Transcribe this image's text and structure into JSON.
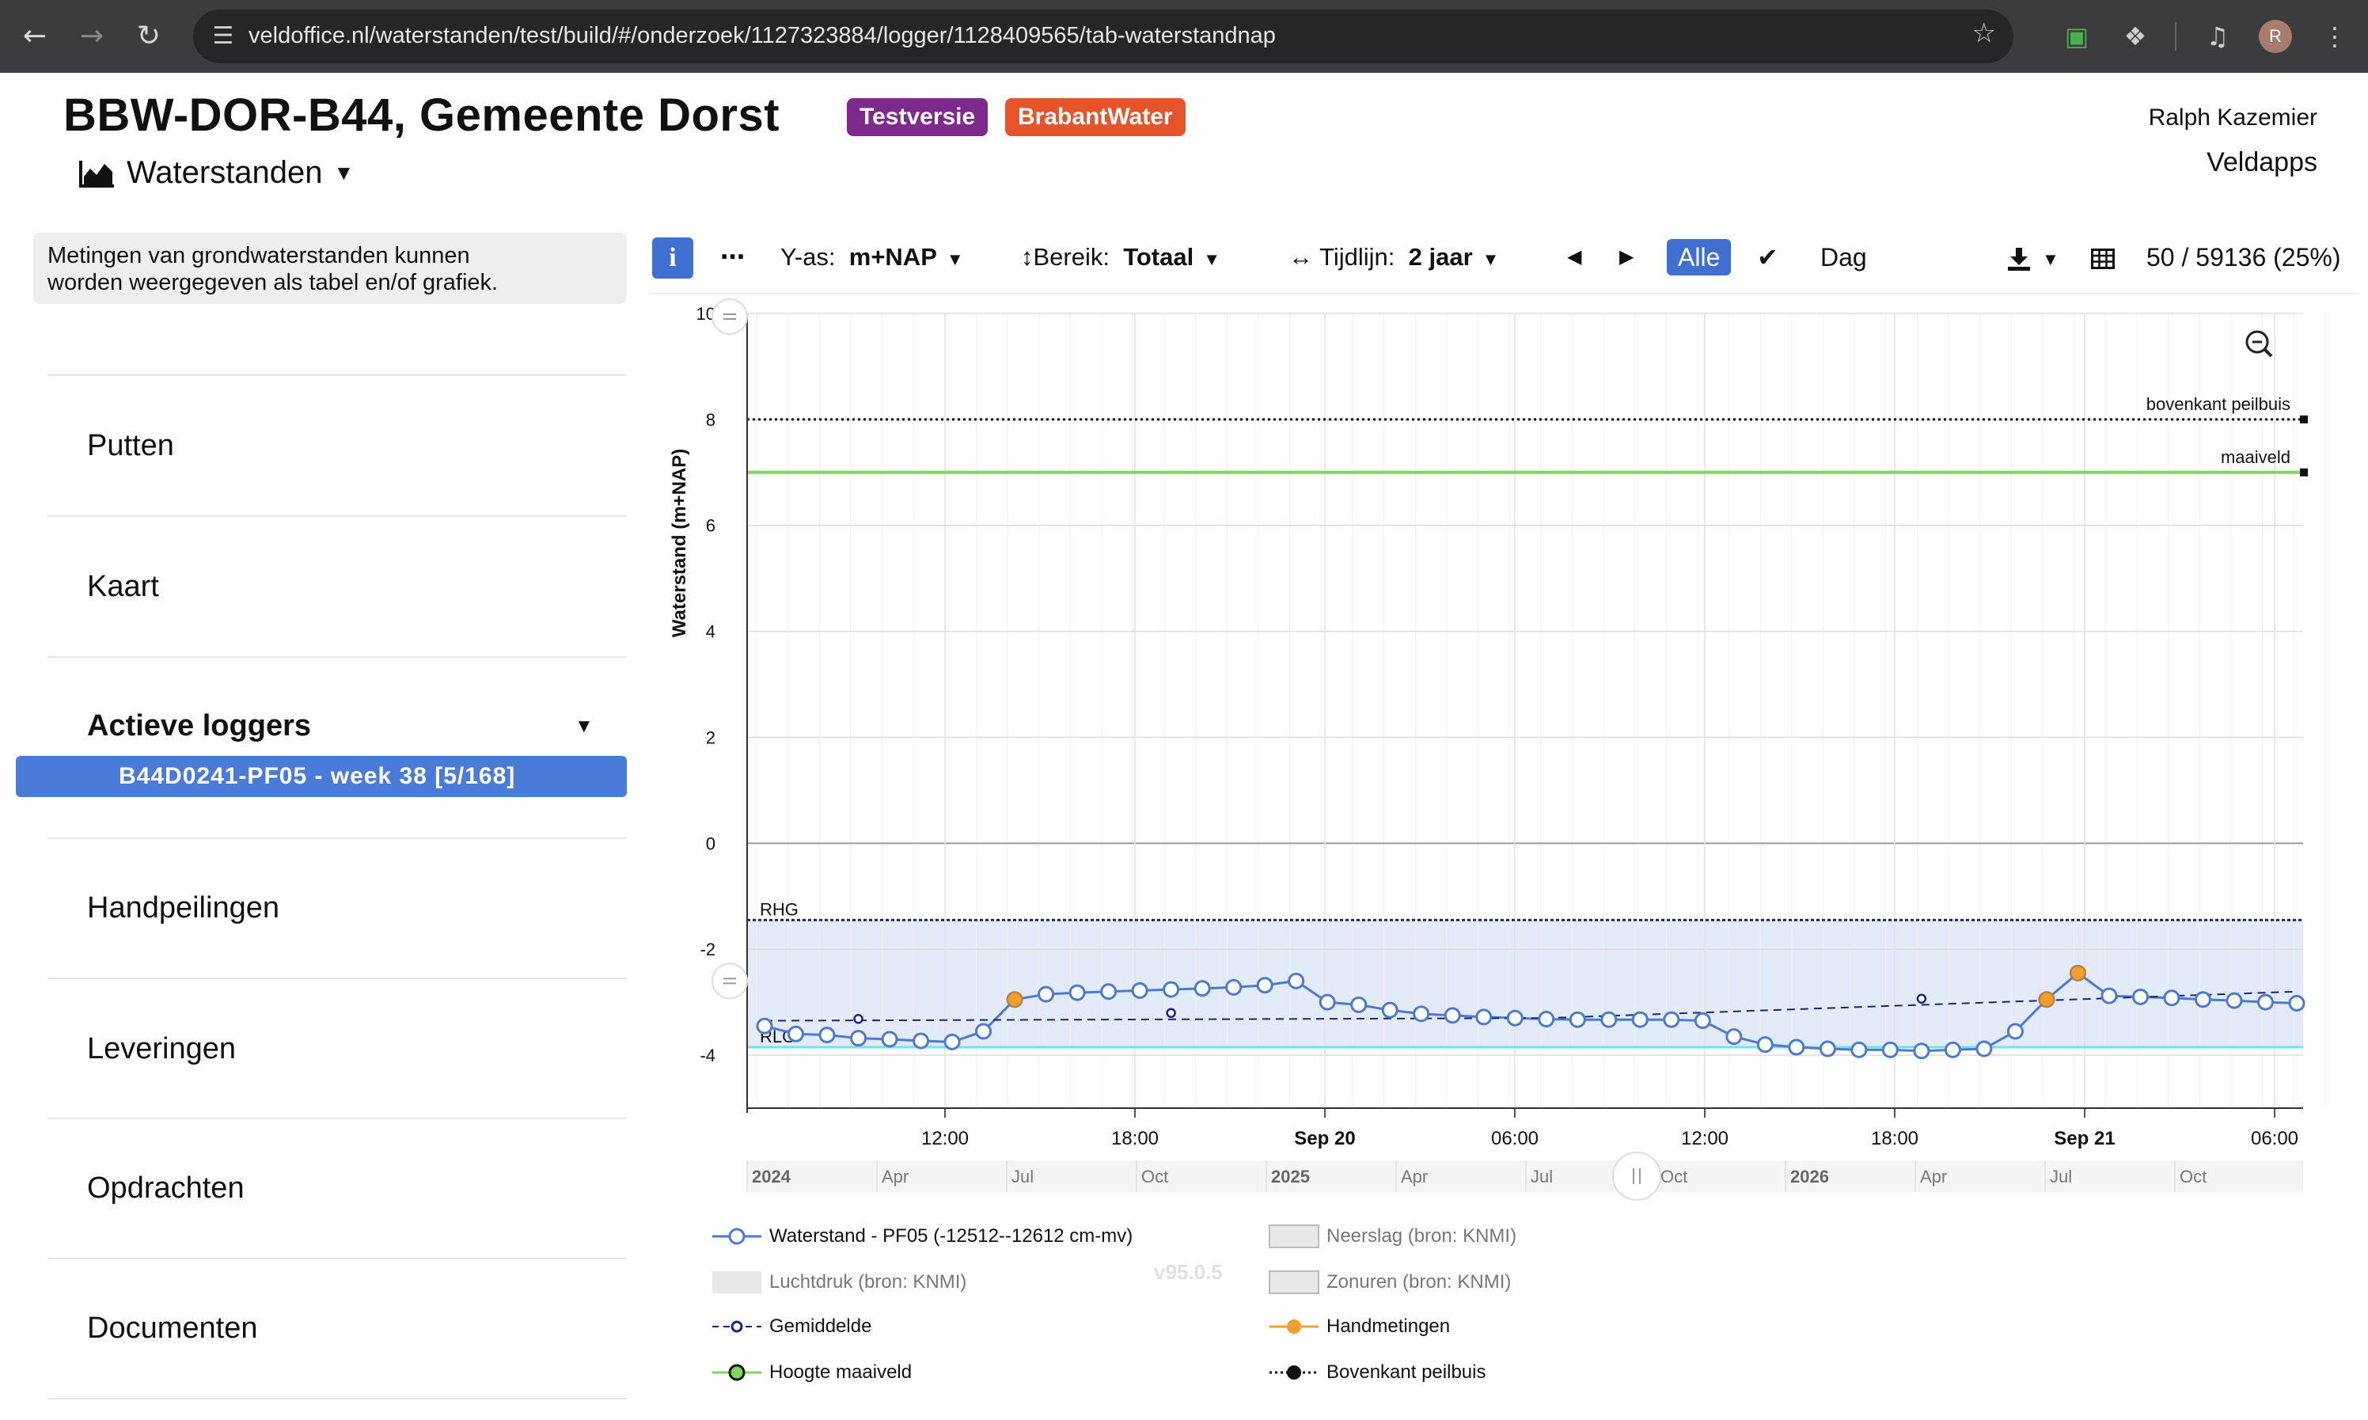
{
  "browser": {
    "url": "veldoffice.nl/waterstanden/test/build/#/onderzoek/1127323884/logger/1128409565/tab-waterstandnap",
    "avatar_letter": "R"
  },
  "header": {
    "title": "BBW-DOR-B44, Gemeente Dorst",
    "badge_test": "Testversie",
    "badge_brand": "BrabantWater",
    "user": "Ralph Kazemier",
    "org": "Veldapps",
    "view_label": "Waterstanden"
  },
  "sidebar": {
    "info_text_1": "Metingen van grondwaterstanden kunnen",
    "info_text_2": "worden weergegeven als tabel en/of grafiek.",
    "items": [
      "Putten",
      "Kaart",
      "Actieve loggers",
      "Handpeilingen",
      "Leveringen",
      "Opdrachten",
      "Documenten"
    ],
    "active_logger": "B44D0241-PF05 - week 38 [5/168]"
  },
  "toolbar": {
    "info": "i",
    "more": "⋯",
    "yas_label": "Y-as:",
    "yas_value": "m+NAP",
    "bereik_label": "Bereik:",
    "bereik_value": "Totaal",
    "tijdlijn_label": "Tijdlijn:",
    "tijdlijn_value": "2 jaar",
    "alle": "Alle",
    "dag": "Dag",
    "count": "50 / 59136 (25%)"
  },
  "chart_data": {
    "type": "line",
    "ylabel": "Waterstand (m+NAP)",
    "ylim": [
      -5,
      10
    ],
    "yticks": [
      10,
      8,
      6,
      4,
      2,
      0,
      -2,
      -4
    ],
    "xticks": [
      "12:00",
      "18:00",
      "Sep 20",
      "06:00",
      "12:00",
      "18:00",
      "Sep 21",
      "06:00"
    ],
    "xticks_bold": [
      false,
      false,
      true,
      false,
      false,
      false,
      true,
      false
    ],
    "navigator_labels": [
      {
        "text": "2024",
        "bold": true
      },
      {
        "text": "Apr",
        "bold": false
      },
      {
        "text": "Jul",
        "bold": false
      },
      {
        "text": "Oct",
        "bold": false
      },
      {
        "text": "2025",
        "bold": true
      },
      {
        "text": "Apr",
        "bold": false
      },
      {
        "text": "Jul",
        "bold": false
      },
      {
        "text": "Oct",
        "bold": false
      },
      {
        "text": "2026",
        "bold": true
      },
      {
        "text": "Apr",
        "bold": false
      },
      {
        "text": "Jul",
        "bold": false
      },
      {
        "text": "Oct",
        "bold": false
      }
    ],
    "reference_lines": [
      {
        "label": "bovenkant peilbuis",
        "value": 8.0
      },
      {
        "label": "maaiveld",
        "value": 7.0
      },
      {
        "label": "RHG",
        "value": -1.45
      },
      {
        "label": "RLG",
        "value": -3.85
      }
    ],
    "band": [
      -3.85,
      -1.45
    ],
    "series": [
      {
        "name": "Waterstand - PF05 (-12512--12612 cm-mv)",
        "color": "#4a7bd0",
        "values": [
          -3.45,
          -3.6,
          -3.62,
          -3.68,
          -3.7,
          -3.73,
          -3.75,
          -3.55,
          -2.95,
          -2.85,
          -2.82,
          -2.8,
          -2.78,
          -2.76,
          -2.74,
          -2.72,
          -2.68,
          -2.6,
          -3.0,
          -3.05,
          -3.15,
          -3.22,
          -3.25,
          -3.28,
          -3.3,
          -3.32,
          -3.33,
          -3.33,
          -3.33,
          -3.33,
          -3.35,
          -3.65,
          -3.8,
          -3.85,
          -3.88,
          -3.9,
          -3.9,
          -3.92,
          -3.9,
          -3.88,
          -3.55,
          -2.95,
          -2.45,
          -2.88,
          -2.9,
          -2.92,
          -2.95,
          -2.97,
          -3.0,
          -3.02
        ]
      },
      {
        "name": "Gemiddelde",
        "color": "#1a237e",
        "values": [
          -3.35,
          -3.3,
          -2.8
        ]
      },
      {
        "name": "Handmetingen",
        "color": "#f0a030",
        "points": [
          [
            8,
            -2.95
          ],
          [
            41,
            -2.95
          ],
          [
            42,
            -2.45
          ]
        ]
      }
    ]
  },
  "legend": [
    {
      "label": "Waterstand - PF05 (-12512--12612 cm-mv)",
      "grey": false
    },
    {
      "label": "Neerslag (bron: KNMI)",
      "grey": true
    },
    {
      "label": "Luchtdruk (bron: KNMI)",
      "grey": true
    },
    {
      "label": "Zonuren (bron: KNMI)",
      "grey": true
    },
    {
      "label": "Gemiddelde",
      "grey": false
    },
    {
      "label": "Handmetingen",
      "grey": false
    },
    {
      "label": "Hoogte maaiveld",
      "grey": false
    },
    {
      "label": "Bovenkant peilbuis",
      "grey": false
    }
  ],
  "version": "v95.0.5"
}
